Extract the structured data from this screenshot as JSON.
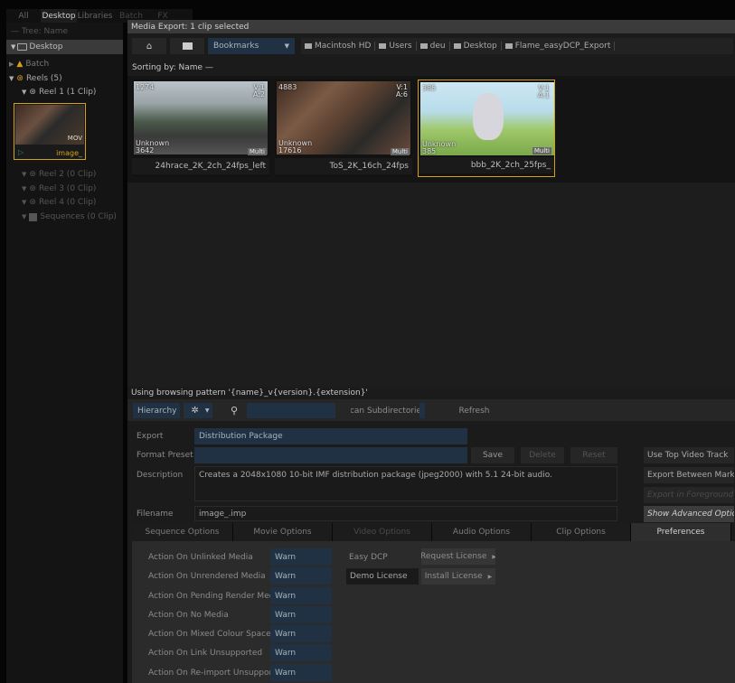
{
  "top_tabs": [
    "All",
    "Desktop",
    "Libraries",
    "Batch",
    "FX"
  ],
  "tree_header": "— Tree: Name",
  "tree": {
    "root": "Desktop",
    "batch": "Batch",
    "reels": "Reels (5)",
    "reel1": "Reel 1 (1 Clip)",
    "clip_thumb_label": "image_",
    "clip_thumb_badge": "MOV",
    "reel2": "Reel 2 (0 Clip)",
    "reel3": "Reel 3 (0 Clip)",
    "reel4": "Reel 4 (0 Clip)",
    "sequences": "Sequences (0 Clip)"
  },
  "media_export_title": "Media Export: 1 clip selected",
  "toolbar": {
    "bookmarks": "Bookmarks",
    "path": [
      "Macintosh HD",
      "Users",
      "deu",
      "Desktop",
      "Flame_easyDCP_Export"
    ]
  },
  "sorting": "Sorting by: Name —",
  "clips": [
    {
      "name": "24hrace_2K_2ch_24fps_left",
      "frame": "1274",
      "tracks_v": "V:1",
      "tracks_a": "A:2",
      "unknown": "Unknown",
      "count": "3642",
      "multi": "Multi"
    },
    {
      "name": "ToS_2K_16ch_24fps",
      "frame": "4883",
      "tracks_v": "V:1",
      "tracks_a": "A:6",
      "unknown": "Unknown",
      "count": "17616",
      "multi": "Multi"
    },
    {
      "name": "bbb_2K_2ch_25fps_",
      "frame": "385",
      "tracks_v": "V:1",
      "tracks_a": "A:1",
      "unknown": "Unknown",
      "count": "385",
      "multi": "Multi"
    }
  ],
  "browse_pattern": "Using browsing pattern '{name}_v{version}.{extension}'",
  "browse_bar": {
    "hierarchy": "Hierarchy",
    "scan": "Scan Subdirectories",
    "refresh": "Refresh"
  },
  "export": {
    "export_label": "Export",
    "export_value": "Distribution Package",
    "format_label": "Format Preset",
    "format_value": "",
    "save": "Save",
    "delete": "Delete",
    "reset": "Reset",
    "description_label": "Description",
    "description_value": "Creates a 2048x1080 10-bit IMF distribution package (jpeg2000) with 5.1 24-bit audio.",
    "filename_label": "Filename",
    "filename_value": "image_.imp"
  },
  "side_buttons": [
    "Use Top Video Track",
    "Export Between Marks",
    "Export in Foreground",
    "Show Advanced Options"
  ],
  "option_tabs": [
    "Sequence Options",
    "Movie Options",
    "Video Options",
    "Audio Options",
    "Clip Options",
    "Preferences"
  ],
  "preferences": {
    "rows": [
      {
        "label": "Action On Unlinked Media",
        "value": "Warn"
      },
      {
        "label": "Action On Unrendered Media",
        "value": "Warn"
      },
      {
        "label": "Action On Pending Render Media",
        "value": "Warn"
      },
      {
        "label": "Action On No Media",
        "value": "Warn"
      },
      {
        "label": "Action On Mixed Colour Space",
        "value": "Warn"
      },
      {
        "label": "Action On Link Unsupported",
        "value": "Warn"
      },
      {
        "label": "Action On Re-import Unsupported",
        "value": "Warn"
      }
    ],
    "easy_dcp": "Easy DCP",
    "request_license": "Request License",
    "demo_license": "Demo License",
    "install_license": "Install License"
  },
  "colors": {
    "accent": "#d4a017",
    "field": "#1f3142",
    "panel": "#1a1a1a"
  }
}
